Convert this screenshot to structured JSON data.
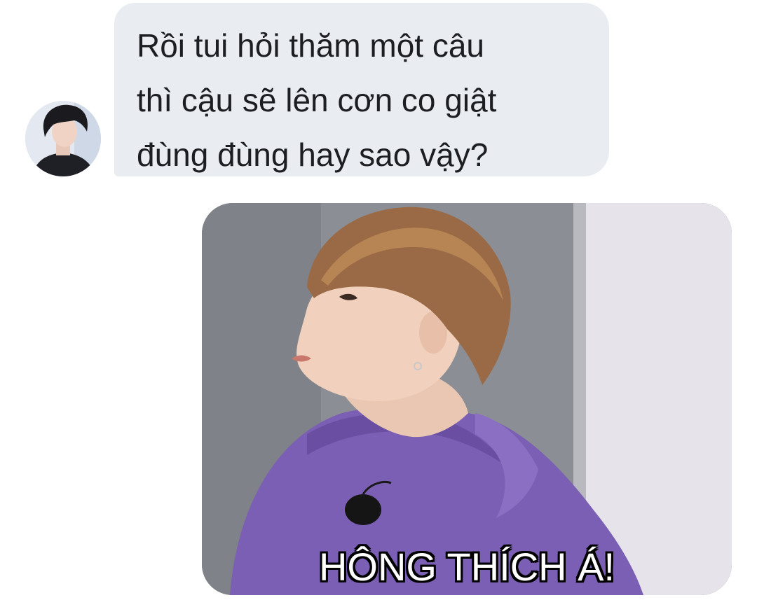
{
  "message": {
    "lines": [
      "Rồi tui hỏi thăm một câu",
      "thì cậu sẽ lên cơn co giật",
      "đùng đùng hay sao vậy?"
    ],
    "bubble_color": "#e9ecf1",
    "text_color": "#1c1e21"
  },
  "reply_image": {
    "caption": "HÔNG THÍCH Á!",
    "hoodie_color": "#7b5fb4"
  }
}
